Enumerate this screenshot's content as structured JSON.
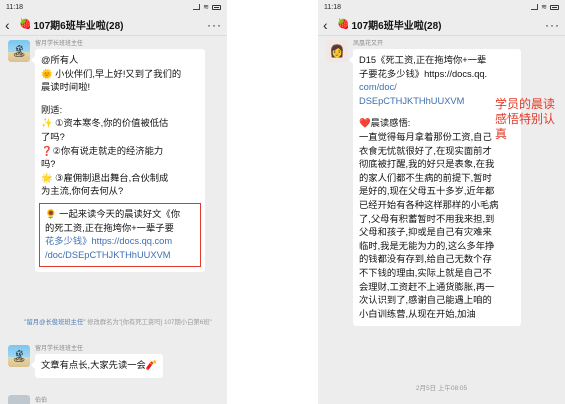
{
  "left": {
    "status": {
      "time": "11:18"
    },
    "nav": {
      "back": "‹",
      "title": "107期6班毕业啦(28)",
      "more": "···"
    },
    "msg1": {
      "sender": "留月学长班班主任",
      "lines": [
        "@所有人",
        "🌞 小伙伴们,早上好!又到了我们的",
        "晨读时间啦!",
        "",
        "刚适:",
        "✨ ①资本寒冬,你的价值被低估",
        "了吗?",
        "❓②你有说走就走的经济能力",
        "吗?",
        "🌟 ③雇佣制退出舞台,合伙制成",
        "为主流,你何去何从?"
      ],
      "highlight_lines": [
        "🌻 一起来读今天的晨读好文《你",
        "的死工资,正在拖垮你+一辈子要",
        "花多少钱》https://docs.qq.com",
        "/doc/DSEpCTHJKTHhUUXVM"
      ]
    },
    "sysnote": {
      "name": "\"留月@长俊班班主任\"",
      "text": "修改群名为\"[你有死工资吗] 107期小白第6班\""
    },
    "msg2": {
      "sender": "留月学长班班主任",
      "text": "文章有点长,大家先读一会🧨"
    },
    "msg3": {
      "sender": "伯伯"
    }
  },
  "right": {
    "status": {
      "time": "11:18"
    },
    "nav": {
      "back": "‹",
      "title": "107期6班毕业啦(28)",
      "more": "···"
    },
    "msg": {
      "sender": "凤凰花又开",
      "lines": [
        "D15《死工资,正在拖垮你+一辈",
        "子要花多少钱》https://docs.qq.",
        "com/doc/",
        "DSEpCTHJKTHhUUXVM",
        "",
        "❤️晨读感悟:",
        "一直觉得每月拿着那份工资,自己",
        "衣食无忧就很好了,在现实面前才",
        "彻底被打醒,我的好只是表象,在我",
        "的家人们都不生病的前提下,暂时",
        "是好的,现在父母五十多岁,近年都",
        "已经开始有各种这样那样的小毛病",
        "了,父母有积蓄暂时不用我来担,到",
        "父母和孩子,抑或是自己有灾难来",
        "临时,我是无能为力的,这么多年挣",
        "的钱都没有存到,给自己无数个存",
        "不下钱的理由,实际上就是自己不",
        "会理财,工资赶不上通货膨胀,再一",
        "次认识到了,感谢自己能遇上咱的",
        "小白训练营,从现在开始,加油"
      ]
    },
    "timestamp": "2月5日 上午08:05"
  },
  "annotation": "学员的晨读感悟特别认真"
}
